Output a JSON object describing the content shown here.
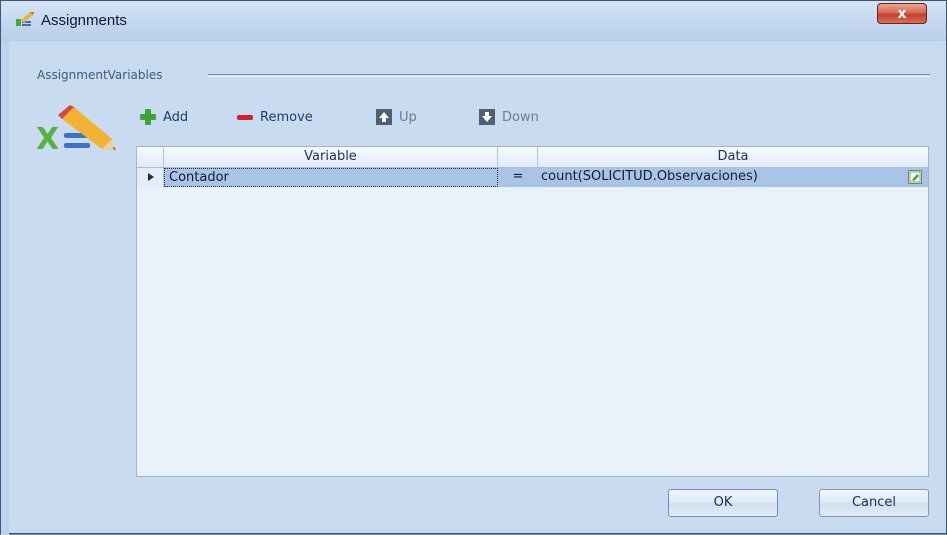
{
  "window": {
    "title": "Assignments",
    "close_label": "x"
  },
  "group": {
    "label": "AssignmentVariables"
  },
  "toolbar": {
    "add_label": "Add",
    "remove_label": "Remove",
    "up_label": "Up",
    "down_label": "Down"
  },
  "grid": {
    "columns": {
      "variable": "Variable",
      "operator": "",
      "data": "Data"
    },
    "rows": [
      {
        "variable": "Contador",
        "operator": "=",
        "data": "count(SOLICITUD.Observaciones)"
      }
    ]
  },
  "buttons": {
    "ok": "OK",
    "cancel": "Cancel"
  },
  "colors": {
    "accent": "#a9c4e6",
    "background": "#c8dbf0",
    "close": "#c2402a"
  }
}
